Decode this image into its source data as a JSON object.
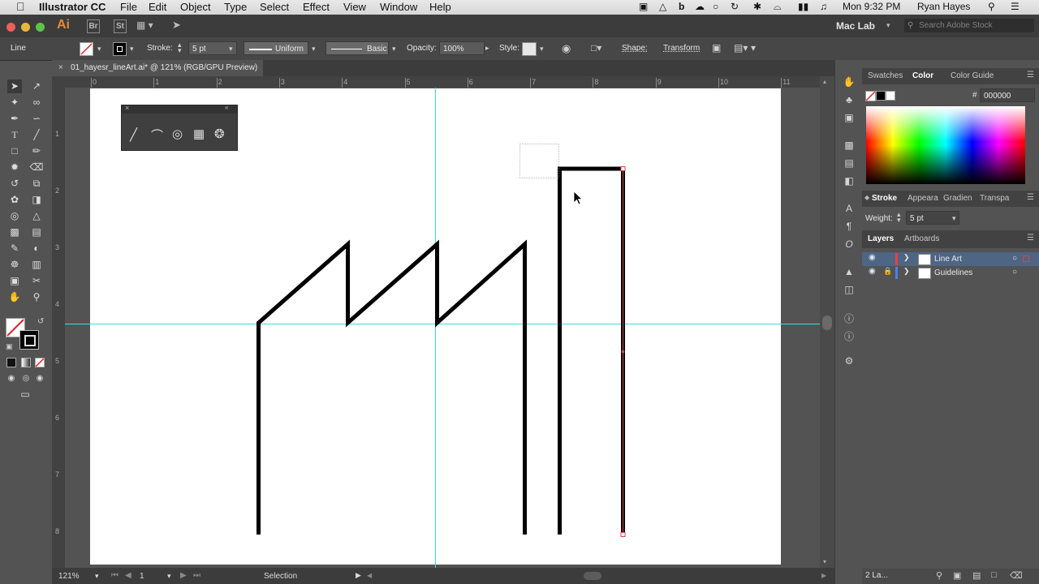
{
  "menubar": {
    "app_name": "Illustrator CC",
    "menus": [
      "File",
      "Edit",
      "Object",
      "Type",
      "Select",
      "Effect",
      "View",
      "Window",
      "Help"
    ],
    "clock": "Mon 9:32 PM",
    "user": "Ryan Hayes"
  },
  "appbar": {
    "logo": "Ai",
    "bridge": "Br",
    "stock": "St",
    "workspace": "Mac Lab",
    "search_placeholder": "Search Adobe Stock"
  },
  "controlbar": {
    "selection_type": "Line",
    "stroke_label": "Stroke:",
    "stroke_weight": "5 pt",
    "profile": "Uniform",
    "brush": "Basic",
    "opacity_label": "Opacity:",
    "opacity_value": "100%",
    "style_label": "Style:",
    "shape_label": "Shape:",
    "transform_label": "Transform"
  },
  "document": {
    "tab_title": "01_hayesr_lineArt.ai* @ 121% (RGB/GPU Preview)",
    "close_glyph": "×"
  },
  "rulers": {
    "horizontal": [
      "0",
      "1",
      "2",
      "3",
      "4",
      "5",
      "6",
      "7",
      "8",
      "9",
      "10",
      "11"
    ],
    "vertical": [
      "1",
      "2",
      "3",
      "4",
      "5",
      "6",
      "7",
      "8"
    ]
  },
  "statusbar": {
    "zoom": "121%",
    "artboard_number": "1",
    "tool_name": "Selection"
  },
  "color_panel": {
    "tabs": [
      "Swatches",
      "Color",
      "Color Guide"
    ],
    "hex_label": "#",
    "hex_value": "000000"
  },
  "stroke_panel": {
    "tabs": [
      "Stroke",
      "Appeara",
      "Gradien",
      "Transpa"
    ],
    "weight_label": "Weight:",
    "weight_value": "5 pt"
  },
  "layers_panel": {
    "tabs": [
      "Layers",
      "Artboards"
    ],
    "layers": [
      {
        "name": "Line Art",
        "color": "#e0424a",
        "selected": true
      },
      {
        "name": "Guidelines",
        "color": "#4f7fe0",
        "selected": false
      }
    ],
    "footer_count": "2 La..."
  },
  "colors": {
    "guide": "#36e0e0",
    "selection": "#e0424a",
    "stroke": "#000000",
    "ai_orange": "#e78a35"
  }
}
